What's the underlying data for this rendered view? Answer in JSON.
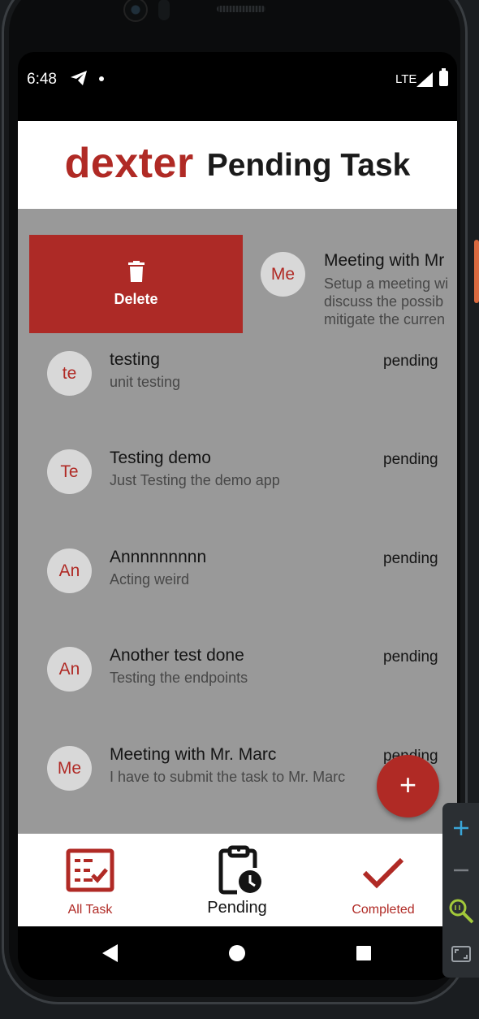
{
  "status_bar": {
    "time": "6:48",
    "network": "LTE"
  },
  "header": {
    "brand": "dexter",
    "title": "Pending Task"
  },
  "swipe_action": {
    "label": "Delete"
  },
  "swiped_task": {
    "avatar": "Me",
    "title": "Meeting with Mr",
    "description_lines": [
      "Setup a meeting wi",
      "discuss the possib",
      "mitigate the curren"
    ]
  },
  "tasks": [
    {
      "avatar": "te",
      "title": "testing",
      "description": "unit testing",
      "status": "pending"
    },
    {
      "avatar": "Te",
      "title": "Testing demo",
      "description": "Just Testing the demo app",
      "status": "pending"
    },
    {
      "avatar": "An",
      "title": "Annnnnnnnn",
      "description": "Acting weird",
      "status": "pending"
    },
    {
      "avatar": "An",
      "title": "Another test done",
      "description": "Testing the endpoints",
      "status": "pending"
    },
    {
      "avatar": "Me",
      "title": "Meeting with Mr. Marc",
      "description": "I have to submit the task to Mr. Marc",
      "status": "pending"
    }
  ],
  "fab": {
    "label": "+"
  },
  "bottom_nav": {
    "items": [
      {
        "label": "All Task",
        "icon": "checklist-icon"
      },
      {
        "label": "Pending",
        "icon": "clipboard-clock-icon"
      },
      {
        "label": "Completed",
        "icon": "checkmark-icon"
      }
    ]
  },
  "colors": {
    "accent": "#b02a25",
    "list_overlay": "#999999",
    "avatar_bg": "#d8d8d8"
  },
  "emulator_toolbar": {
    "icons": [
      "zoom-in-icon",
      "zoom-out-icon",
      "zoom-actual-size-icon",
      "fit-screen-icon"
    ]
  }
}
